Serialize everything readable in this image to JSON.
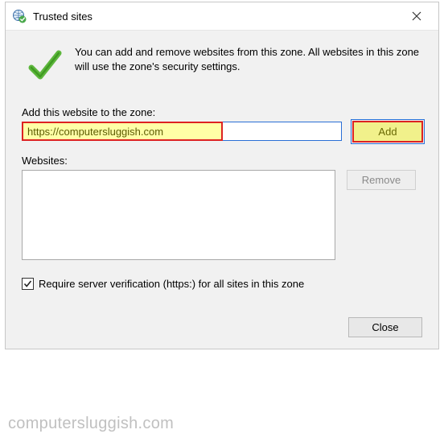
{
  "title": "Trusted sites",
  "intro": "You can add and remove websites from this zone. All websites in this zone will use the zone's security settings.",
  "labels": {
    "add": "Add this website to the zone:",
    "list": "Websites:",
    "require": "Require server verification (https:) for all sites in this zone"
  },
  "input": {
    "value": "https://computersluggish.com"
  },
  "buttons": {
    "add": "Add",
    "remove": "Remove",
    "close": "Close"
  },
  "checkbox": {
    "checked": true
  },
  "websites": [],
  "watermark": "computersluggish.com"
}
